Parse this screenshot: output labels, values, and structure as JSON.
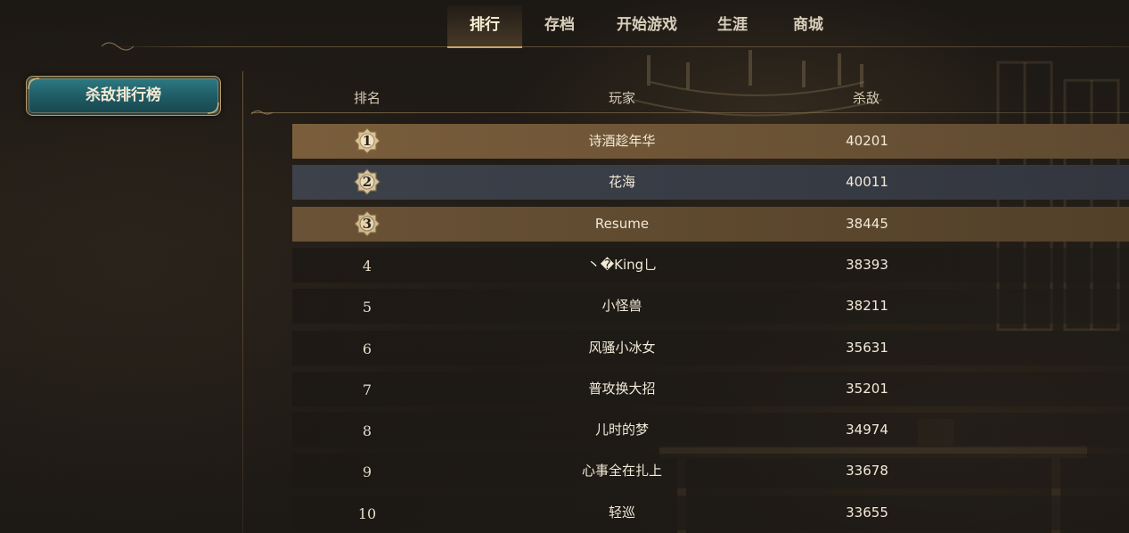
{
  "nav": {
    "tabs": [
      {
        "label": "排行",
        "active": true
      },
      {
        "label": "存档",
        "active": false
      },
      {
        "label": "开始游戏",
        "active": false
      },
      {
        "label": "生涯",
        "active": false
      },
      {
        "label": "商城",
        "active": false
      }
    ]
  },
  "sidebar": {
    "kill_leaderboard_label": "杀敌排行榜"
  },
  "table": {
    "headers": {
      "rank": "排名",
      "player": "玩家",
      "kills": "杀敌"
    },
    "rows": [
      {
        "rank": "1",
        "player": "诗酒趁年华",
        "kills": "40201",
        "tier": "gold"
      },
      {
        "rank": "2",
        "player": "花海",
        "kills": "40011",
        "tier": "silver"
      },
      {
        "rank": "3",
        "player": "Resume",
        "kills": "38445",
        "tier": "bronze"
      },
      {
        "rank": "4",
        "player": "丶�King乚",
        "kills": "38393",
        "tier": "normal"
      },
      {
        "rank": "5",
        "player": "小怪兽",
        "kills": "38211",
        "tier": "normal"
      },
      {
        "rank": "6",
        "player": "风骚小冰女",
        "kills": "35631",
        "tier": "normal"
      },
      {
        "rank": "7",
        "player": "普攻换大招",
        "kills": "35201",
        "tier": "normal"
      },
      {
        "rank": "8",
        "player": "儿时的梦",
        "kills": "34974",
        "tier": "normal"
      },
      {
        "rank": "9",
        "player": "心事全在扎上",
        "kills": "33678",
        "tier": "normal"
      },
      {
        "rank": "10",
        "player": "轻巡",
        "kills": "33655",
        "tier": "normal"
      }
    ]
  },
  "colors": {
    "gold_row": "#7a5e3c",
    "silver_row": "#3d414a",
    "bronze_row": "#6a5236",
    "sidebar_teal": "#2f7c86",
    "accent_trim": "#b79a6a"
  }
}
